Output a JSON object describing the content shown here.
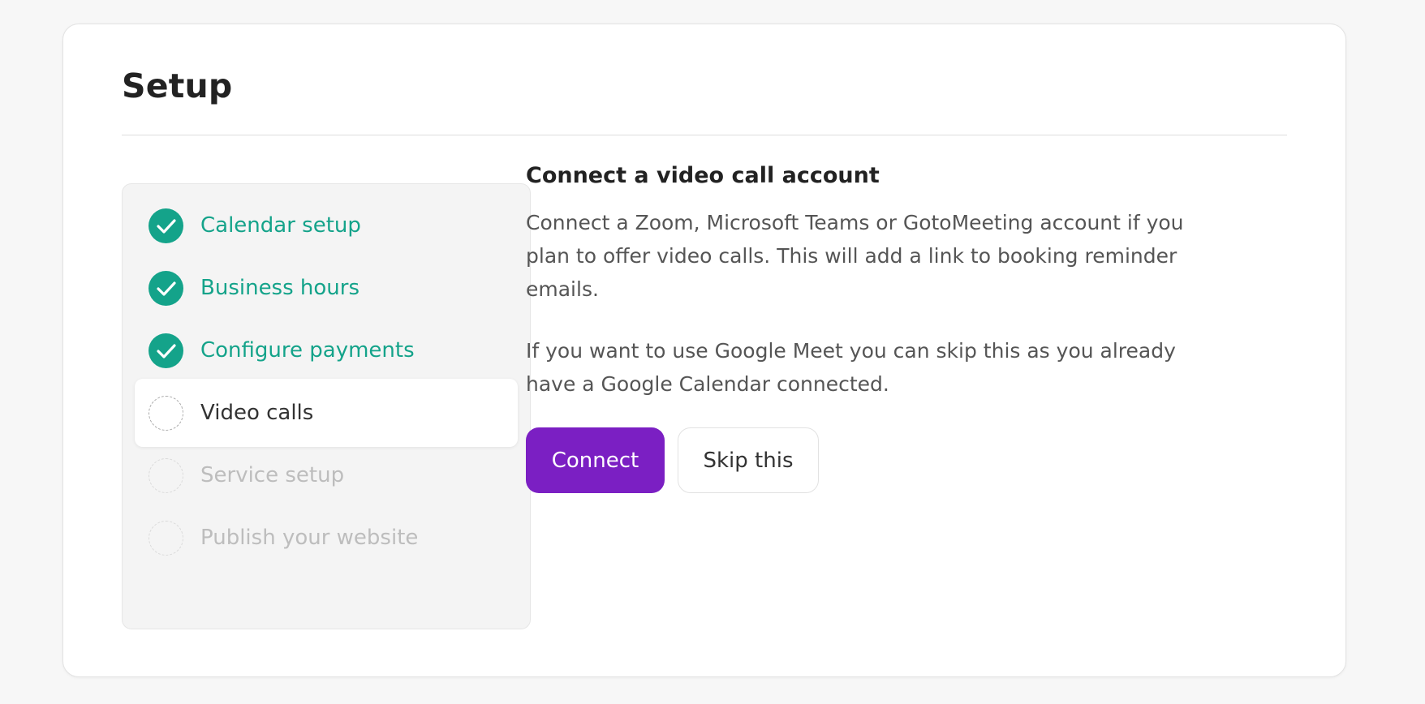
{
  "page": {
    "title": "Setup"
  },
  "steps": [
    {
      "label": "Calendar setup",
      "status": "done",
      "icon": "check-circle-icon"
    },
    {
      "label": "Business hours",
      "status": "done",
      "icon": "check-circle-icon"
    },
    {
      "label": "Configure payments",
      "status": "done",
      "icon": "check-circle-icon"
    },
    {
      "label": "Video calls",
      "status": "current",
      "icon": "dashed-circle-icon"
    },
    {
      "label": "Service setup",
      "status": "upcoming",
      "icon": "dashed-circle-icon"
    },
    {
      "label": "Publish your website",
      "status": "upcoming",
      "icon": "dashed-circle-icon"
    }
  ],
  "content": {
    "heading": "Connect a video call account",
    "paragraph1": "Connect a Zoom, Microsoft Teams or GotoMeeting account if you plan to offer video calls. This will add a link to booking reminder emails.",
    "paragraph2": "If you want to use Google Meet you can skip this as you already have a Google Calendar connected."
  },
  "actions": {
    "connect_label": "Connect",
    "skip_label": "Skip this"
  },
  "colors": {
    "done": "#14a38a",
    "primary": "#7b1fc3",
    "upcoming_text": "#bdbdbd"
  }
}
